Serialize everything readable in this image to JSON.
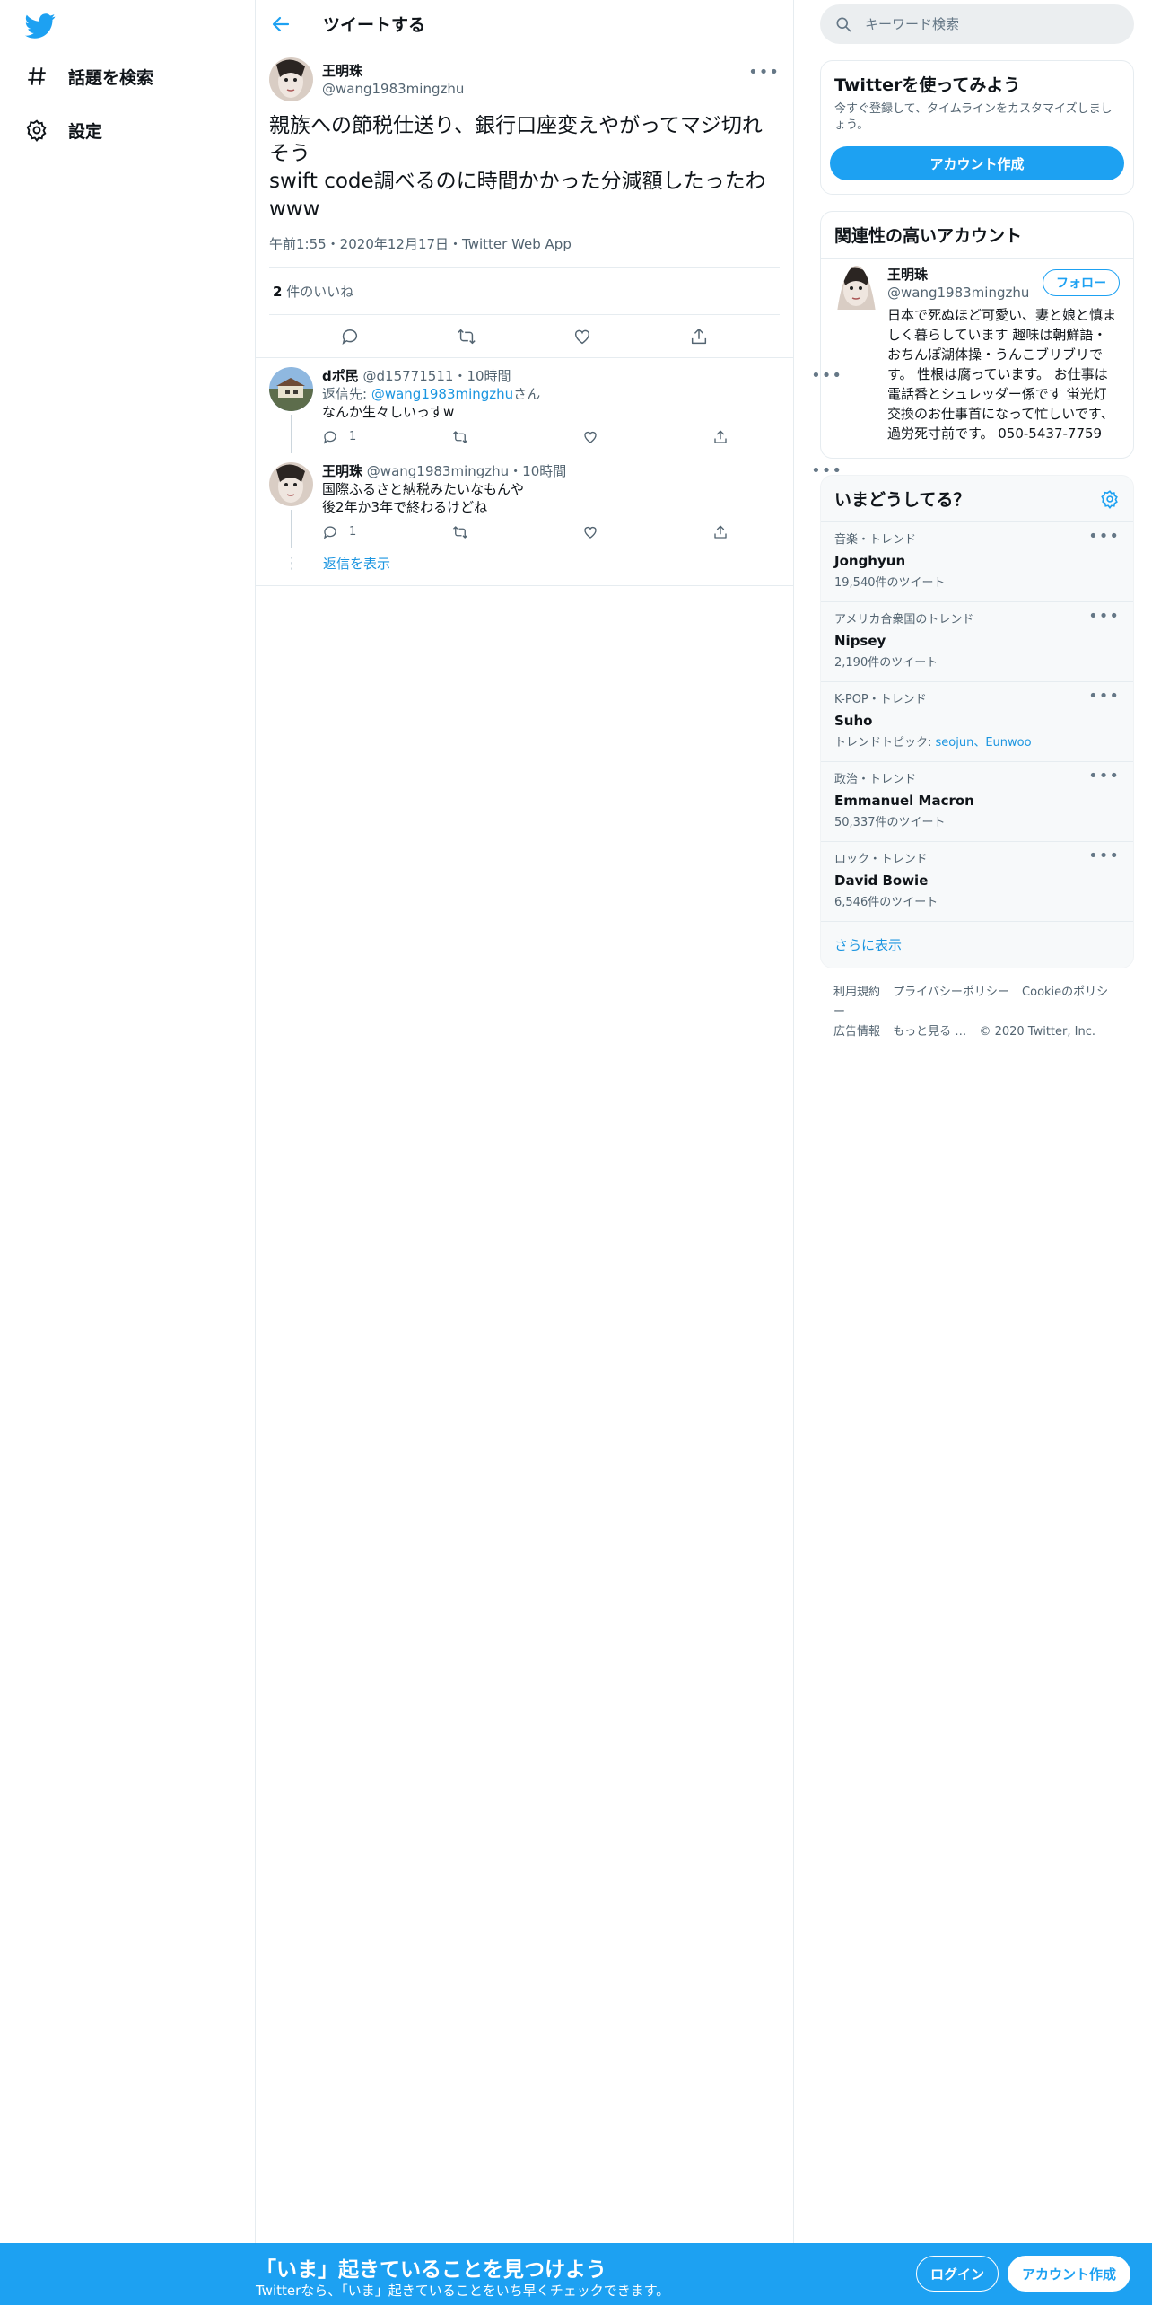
{
  "nav": {
    "items": [
      {
        "label": "話題を検索",
        "icon": "hashtag-icon"
      },
      {
        "label": "設定",
        "icon": "gear-icon"
      }
    ]
  },
  "header": {
    "title": "ツイートする"
  },
  "main_tweet": {
    "name": "王明珠",
    "handle": "@wang1983mingzhu",
    "text": "親族への節税仕送り、銀行口座変えやがってマジ切れそう\nswift code調べるのに時間かかった分減額したったわwww",
    "meta": "午前1:55・2020年12月17日・Twitter Web App",
    "likes_count": "2",
    "likes_label": "件のいいね"
  },
  "replies": [
    {
      "name": "dポ民",
      "handle": "@d15771511",
      "time": "・10時間",
      "reply_to_prefix": "返信先: ",
      "reply_to_handle": "@wang1983mingzhu",
      "reply_to_suffix": "さん",
      "text": "なんか生々しいっすw",
      "reply_count": "1"
    },
    {
      "name": "王明珠",
      "handle": "@wang1983mingzhu",
      "time": "・10時間",
      "text": "国際ふるさと納税みたいなもんや\n後2年か3年で終わるけどね",
      "reply_count": "1"
    }
  ],
  "show_replies": "返信を表示",
  "search": {
    "placeholder": "キーワード検索"
  },
  "signup_card": {
    "title": "Twitterを使ってみよう",
    "desc": "今すぐ登録して、タイムラインをカスタマイズしましょう。",
    "button": "アカウント作成"
  },
  "related": {
    "title": "関連性の高いアカウント",
    "name": "王明珠",
    "handle": "@wang1983mingzhu",
    "follow": "フォロー",
    "bio": "日本で死ぬほど可愛い、妻と娘と慎ましく暮らしています 趣味は朝鮮語・おちんぽ湖体操・うんこブリブリです。 性根は腐っています。 お仕事は電話番とシュレッダー係です 蛍光灯交換のお仕事首になって忙しいです、過労死寸前です。 050-5437-7759"
  },
  "trends": {
    "title": "いまどうしてる？",
    "items": [
      {
        "context": "音楽・トレンド",
        "name": "Jonghyun",
        "count": "19,540件のツイート"
      },
      {
        "context": "アメリカ合衆国のトレンド",
        "name": "Nipsey",
        "count": "2,190件のツイート"
      },
      {
        "context": "K-POP・トレンド",
        "name": "Suho",
        "topic_prefix": "トレンドトピック: ",
        "topics": "seojun、Eunwoo"
      },
      {
        "context": "政治・トレンド",
        "name": "Emmanuel Macron",
        "count": "50,337件のツイート"
      },
      {
        "context": "ロック・トレンド",
        "name": "David Bowie",
        "count": "6,546件のツイート"
      }
    ],
    "show_more": "さらに表示"
  },
  "footer": {
    "links": [
      "利用規約",
      "プライバシーポリシー",
      "Cookieのポリシー",
      "広告情報",
      "もっと見る …"
    ],
    "copyright": "© 2020 Twitter, Inc."
  },
  "bottom_bar": {
    "title": "「いま」起きていることを見つけよう",
    "subtitle": "Twitterなら、「いま」起きていることをいち早くチェックできます。",
    "login": "ログイン",
    "signup": "アカウント作成"
  },
  "colors": {
    "accent": "#1da1f2",
    "link": "#1b95e0",
    "muted": "#536471"
  }
}
